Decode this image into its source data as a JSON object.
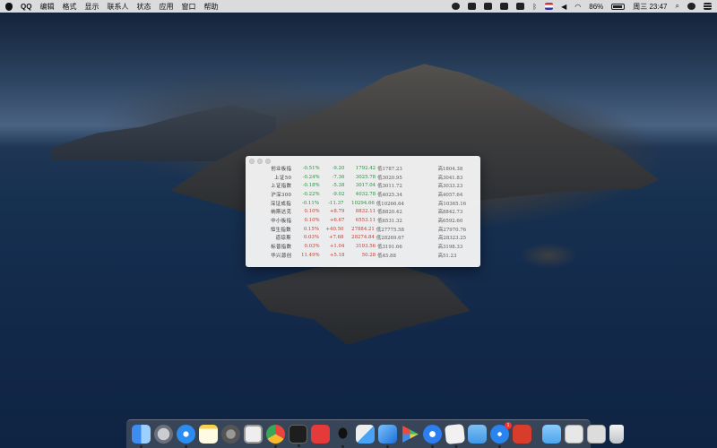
{
  "menubar": {
    "app_name": "QQ",
    "menus": [
      "编辑",
      "格式",
      "显示",
      "联系人",
      "状态",
      "应用",
      "窗口",
      "帮助"
    ],
    "battery": "86%",
    "clock": "周三 23:47",
    "status_icons": [
      "qq-icon",
      "cloud-icon",
      "screen-icon",
      "display-icon",
      "window-icon",
      "bluetooth-icon",
      "flag-icon",
      "volume-icon",
      "wifi-icon",
      "battery-icon",
      "search-icon",
      "siri-icon",
      "list-icon"
    ]
  },
  "stock_widget": {
    "rows": [
      {
        "name": "创业板指",
        "pct": "-0.51%",
        "chg": "-9.20",
        "price": "1792.42",
        "low": "低1787.23",
        "high": "高1804.38",
        "dir": "down"
      },
      {
        "name": "上证50",
        "pct": "-0.24%",
        "chg": "-7.36",
        "price": "3025.78",
        "low": "低3020.95",
        "high": "高3041.83",
        "dir": "down"
      },
      {
        "name": "上证指数",
        "pct": "-0.18%",
        "chg": "-5.38",
        "price": "3017.04",
        "low": "低3011.72",
        "high": "高3033.23",
        "dir": "down"
      },
      {
        "name": "沪深300",
        "pct": "-0.22%",
        "chg": "-9.02",
        "price": "4032.78",
        "low": "低4025.34",
        "high": "高4057.64",
        "dir": "down"
      },
      {
        "name": "深证成指",
        "pct": "-0.11%",
        "chg": "-11.37",
        "price": "10294.66",
        "low": "低10266.64",
        "high": "高10365.16",
        "dir": "down"
      },
      {
        "name": "纳斯达克",
        "pct": "0.10%",
        "chg": "+8.79",
        "price": "8832.11",
        "low": "低8820.42",
        "high": "高8842.73",
        "dir": "up"
      },
      {
        "name": "中小板指",
        "pct": "0.10%",
        "chg": "+6.67",
        "price": "6553.11",
        "low": "低6531.32",
        "high": "高6592.60",
        "dir": "up"
      },
      {
        "name": "恒生指数",
        "pct": "0.15%",
        "chg": "+40.50",
        "price": "27884.21",
        "low": "低27775.58",
        "high": "高27970.76",
        "dir": "up"
      },
      {
        "name": "道琼斯",
        "pct": "0.03%",
        "chg": "+7.68",
        "price": "28274.84",
        "low": "低28269.67",
        "high": "高28323.25",
        "dir": "up"
      },
      {
        "name": "标普指数",
        "pct": "0.03%",
        "chg": "+1.04",
        "price": "3193.56",
        "low": "低3191.66",
        "high": "高3198.33",
        "dir": "up"
      },
      {
        "name": "华兴源创",
        "pct": "11.49%",
        "chg": "+5.18",
        "price": "50.28",
        "low": "低45.88",
        "high": "高51.23",
        "dir": "up"
      }
    ]
  },
  "dock": {
    "items": [
      {
        "name": "finder-icon",
        "cls": "ic-finder",
        "running": true
      },
      {
        "name": "launchpad-icon",
        "cls": "ic-launch",
        "running": false
      },
      {
        "name": "safari-icon",
        "cls": "ic-safari",
        "running": true
      },
      {
        "name": "notes-icon",
        "cls": "ic-notes",
        "running": false
      },
      {
        "name": "system-preferences-icon",
        "cls": "ic-prefs",
        "running": false
      },
      {
        "name": "screenshot-icon",
        "cls": "ic-photo",
        "running": false
      },
      {
        "name": "chrome-icon",
        "cls": "ic-chrome",
        "running": true
      },
      {
        "name": "terminal-icon",
        "cls": "ic-term",
        "running": true
      },
      {
        "name": "youdao-icon",
        "cls": "ic-youdao",
        "running": false
      },
      {
        "name": "qq-icon",
        "cls": "ic-qq",
        "running": true
      },
      {
        "name": "xcode-icon",
        "cls": "ic-xcode",
        "running": false
      },
      {
        "name": "xcode-instruments-icon",
        "cls": "ic-xcode2",
        "running": true
      },
      {
        "name": "play-icon",
        "cls": "ic-play",
        "running": false
      },
      {
        "name": "maps-icon",
        "cls": "ic-maps",
        "running": true
      },
      {
        "name": "textedit-icon",
        "cls": "ic-textedit",
        "running": true
      },
      {
        "name": "folder-icon",
        "cls": "ic-folder",
        "running": false
      },
      {
        "name": "app-store-icon",
        "cls": "ic-appstore",
        "running": true,
        "badge": "1"
      },
      {
        "name": "book-icon",
        "cls": "ic-book",
        "running": false
      }
    ],
    "right_items": [
      {
        "name": "downloads-folder-icon",
        "cls": "ic-folder2"
      },
      {
        "name": "window-thumbnail-icon",
        "cls": "ic-win1"
      },
      {
        "name": "window-thumbnail-icon",
        "cls": "ic-win2"
      },
      {
        "name": "trash-icon",
        "cls": "ic-trash"
      }
    ]
  }
}
